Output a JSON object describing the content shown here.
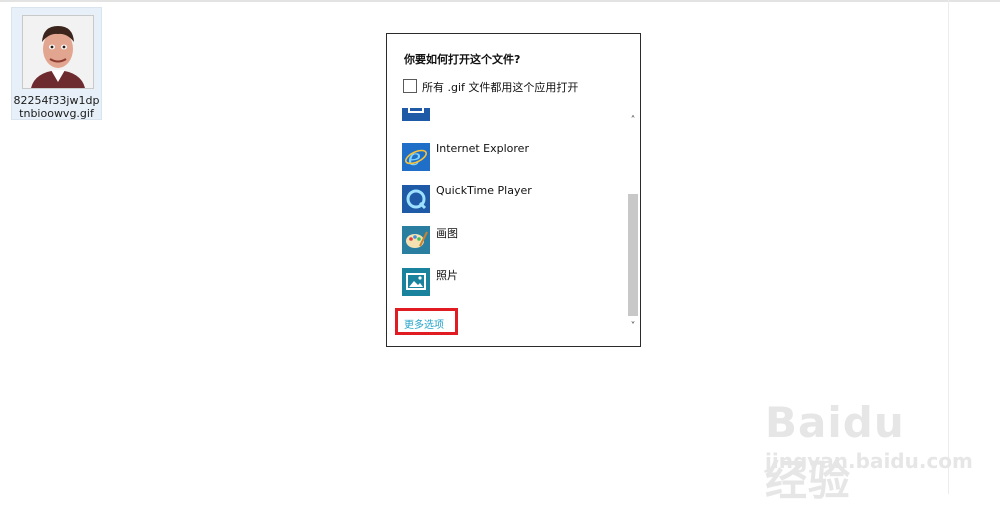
{
  "desktop": {
    "file": {
      "name_line1": "82254f33jw1dp",
      "name_line2": "tnbioowvg.gif"
    }
  },
  "dialog": {
    "title": "你要如何打开这个文件?",
    "checkbox_label": "所有 .gif 文件都用这个应用打开",
    "apps": [
      {
        "label": "",
        "icon": "partial-app-icon"
      },
      {
        "label": "Internet Explorer",
        "icon": "internet-explorer-icon"
      },
      {
        "label": "QuickTime Player",
        "icon": "quicktime-icon"
      },
      {
        "label": "画图",
        "icon": "paint-icon"
      },
      {
        "label": "照片",
        "icon": "photos-icon"
      }
    ],
    "more_options": "更多选项"
  },
  "watermark": {
    "main": "Baidu经验",
    "sub": "jingyan.baidu.com"
  },
  "colors": {
    "highlight_border": "#e11b22",
    "link": "#26a3c9",
    "app_tile": "#1e5aa6",
    "paint_tile": "#2a7fa0",
    "photos_tile": "#19829c"
  }
}
